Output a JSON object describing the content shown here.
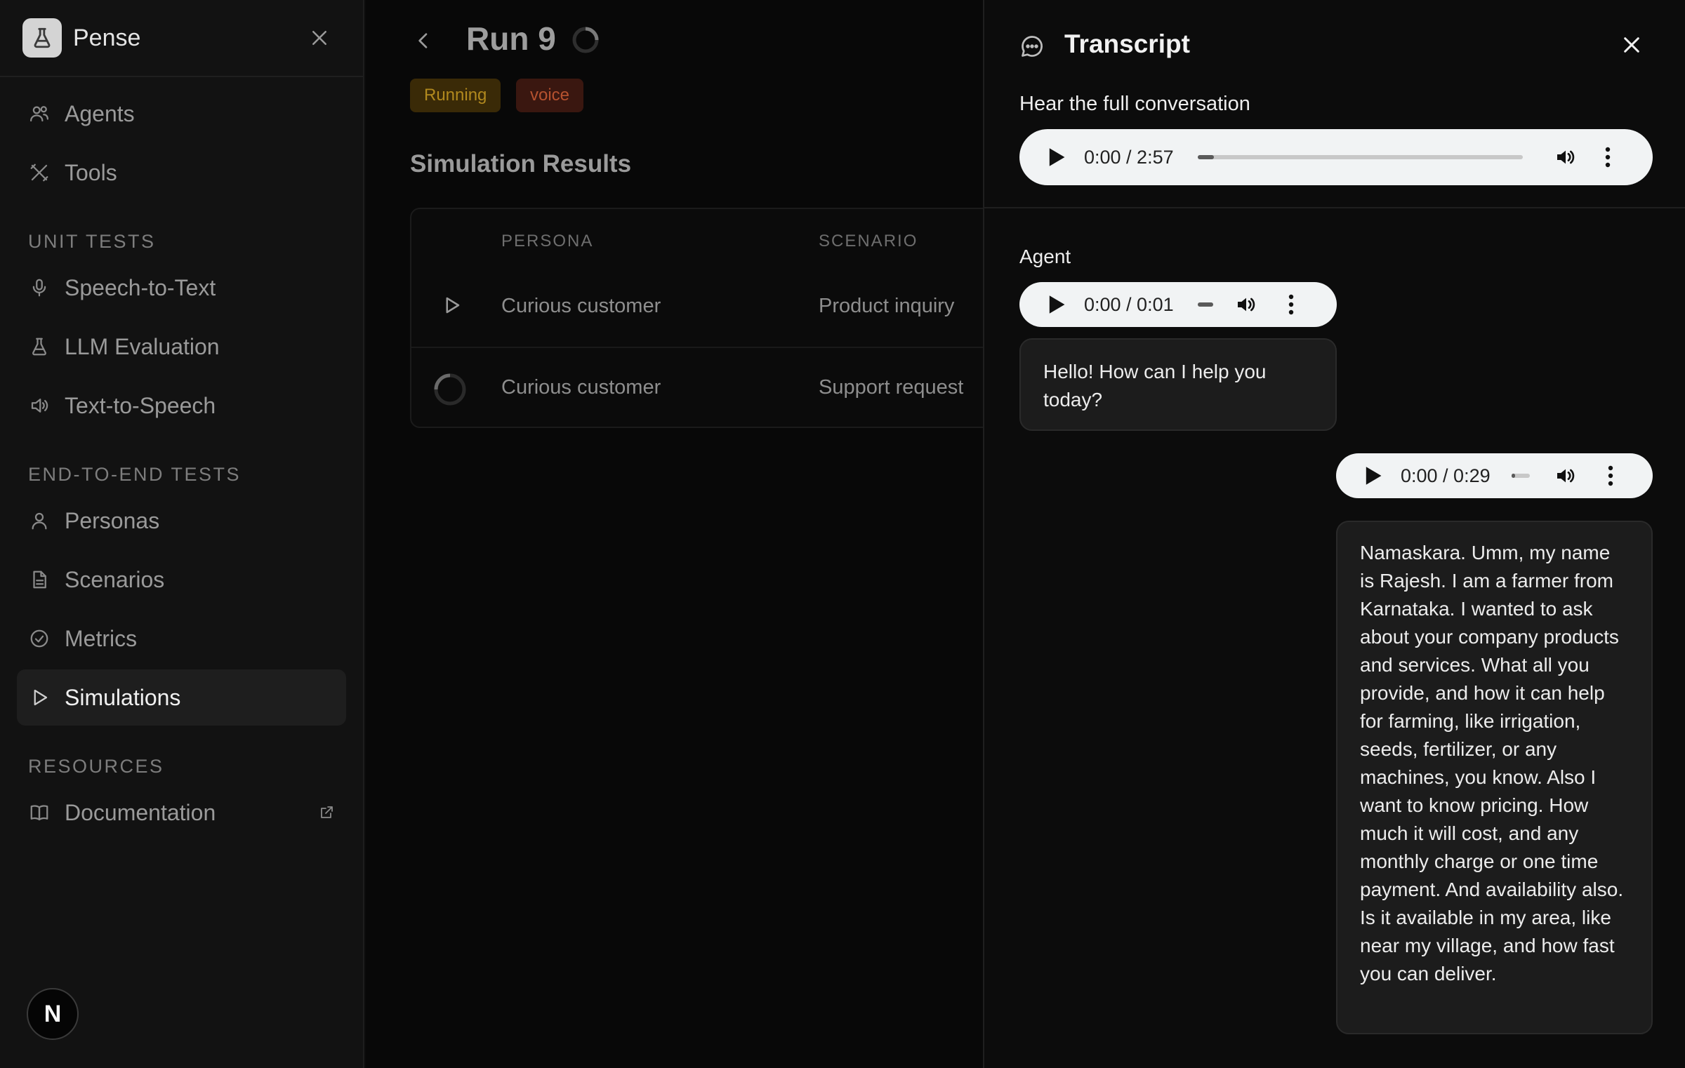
{
  "sidebar": {
    "brand": "Pense",
    "items_top": [
      {
        "label": "Agents",
        "icon": "users-icon"
      },
      {
        "label": "Tools",
        "icon": "tools-icon"
      }
    ],
    "sections": [
      {
        "title": "UNIT TESTS",
        "items": [
          {
            "label": "Speech-to-Text",
            "icon": "mic-icon"
          },
          {
            "label": "LLM Evaluation",
            "icon": "flask-icon"
          },
          {
            "label": "Text-to-Speech",
            "icon": "speaker-icon"
          }
        ]
      },
      {
        "title": "END-TO-END TESTS",
        "items": [
          {
            "label": "Personas",
            "icon": "person-icon"
          },
          {
            "label": "Scenarios",
            "icon": "document-icon"
          },
          {
            "label": "Metrics",
            "icon": "check-circle-icon"
          },
          {
            "label": "Simulations",
            "icon": "play-icon"
          }
        ]
      },
      {
        "title": "RESOURCES",
        "items": [
          {
            "label": "Documentation",
            "icon": "book-icon"
          }
        ]
      }
    ],
    "active_item": "Simulations",
    "avatar_letter": "N"
  },
  "main": {
    "run_title": "Run 9",
    "badges": {
      "status": "Running",
      "mode": "voice"
    },
    "section_title": "Simulation Results",
    "table": {
      "headers": {
        "persona": "PERSONA",
        "scenario": "SCENARIO"
      },
      "rows": [
        {
          "persona": "Curious customer",
          "scenario": "Product inquiry",
          "state": "play"
        },
        {
          "persona": "Curious customer",
          "scenario": "Support request",
          "state": "loading"
        }
      ]
    }
  },
  "transcript": {
    "title": "Transcript",
    "full_label": "Hear the full conversation",
    "full_player": {
      "time": "0:00 / 2:57",
      "progress": 0.05
    },
    "messages": [
      {
        "speaker": "Agent",
        "player_time": "0:00 / 0:01",
        "text": "Hello! How can I help you today?"
      },
      {
        "speaker": "",
        "player_time": "0:00 / 0:29",
        "text": "Namaskara. Umm, my name is Rajesh. I am a farmer from Karnataka. I wanted to ask about your company products and services. What all you provide, and how it can help for farming, like irrigation, seeds, fertilizer, or any machines, you know. Also I want to know pricing. How much it will cost, and any monthly charge or one time payment. And availability also. Is it available in my area, like near my village, and how fast you can deliver."
      }
    ]
  },
  "colors": {
    "running_badge_bg": "#3a2a07",
    "running_badge_text": "#b1891e",
    "voice_badge_bg": "#3a1710",
    "voice_badge_text": "#b5522f",
    "bubble_bg": "#1c1c1c"
  }
}
